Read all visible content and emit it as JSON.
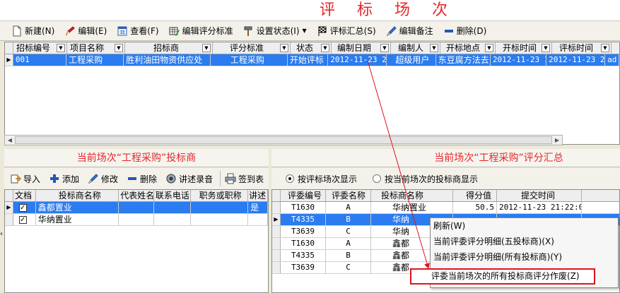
{
  "title": "评 标 场 次",
  "toolbar": {
    "new": "新建(N)",
    "edit": "编辑(E)",
    "view": "查看(F)",
    "edit_criteria": "编辑评分标准",
    "set_status": "设置状态(I)",
    "summary": "评标汇总(S)",
    "edit_note": "编辑备注",
    "delete": "删除(D)"
  },
  "top_grid": {
    "headers": [
      "招标编号",
      "项目名称",
      "招标商",
      "评分标准",
      "状态",
      "编制日期",
      "编制人",
      "开标地点",
      "开标时间",
      "评标时间"
    ],
    "rows": [
      [
        "001",
        "工程采购",
        "胜利油田物资供应处",
        "工程采购",
        "开始评标",
        "2012-11-23 2",
        "超级用户",
        "东豆腐方法去",
        "2012-11-23 1",
        "2012-11-23 21",
        "ad"
      ]
    ]
  },
  "left_panel": {
    "title": "当前场次“工程采购”投标商",
    "toolbar": {
      "import": "导入",
      "add": "添加",
      "modify": "修改",
      "delete": "删除",
      "record": "讲述录音",
      "signin": "签到表"
    },
    "headers": [
      "文档",
      "投标商名称",
      "代表姓名",
      "联系电话",
      "职务或职称",
      "讲述"
    ],
    "rows": [
      {
        "name": "鑫都置业",
        "speech": "是"
      },
      {
        "name": "华纳置业",
        "speech": ""
      }
    ]
  },
  "right_panel": {
    "title": "当前场次“工程采购”评分汇总",
    "radio_by_session": "按评标场次显示",
    "radio_by_bidder": "按当前场次的投标商显示",
    "headers": [
      "评委编号",
      "评委名称",
      "投标商名称",
      "得分值",
      "提交时间"
    ],
    "rows": [
      [
        "T1630",
        "A",
        "华纳置业",
        "50.5",
        "2012-11-23 21:22:00"
      ],
      [
        "T4335",
        "B",
        "华纳",
        "",
        ""
      ],
      [
        "T3639",
        "C",
        "华纳",
        "",
        ""
      ],
      [
        "T1630",
        "A",
        "鑫都",
        "",
        ""
      ],
      [
        "T4335",
        "B",
        "鑫都",
        "",
        ""
      ],
      [
        "T3639",
        "C",
        "鑫都",
        "",
        ""
      ]
    ]
  },
  "context_menu": {
    "items": [
      "刷新(W)",
      "当前评委评分明细(五投标商)(X)",
      "当前评委评分明细(所有投标商)(Y)"
    ],
    "highlight": "评委当前场次的所有投标商评分作废(Z)"
  },
  "colors": {
    "accent_red": "#e8262a",
    "selection_blue": "#2a7cf0"
  }
}
